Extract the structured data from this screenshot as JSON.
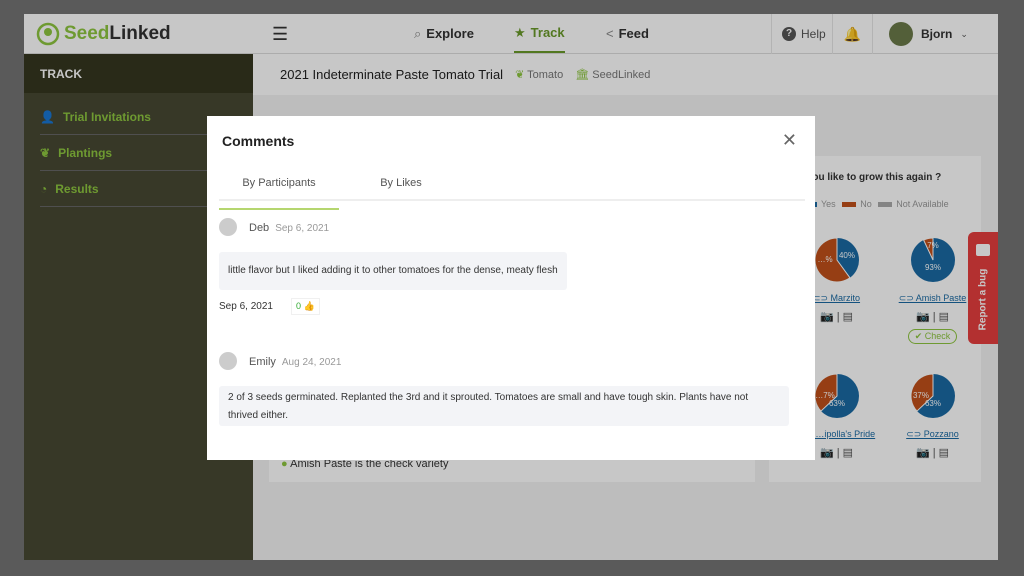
{
  "header": {
    "logo_seed": "Seed",
    "logo_linked": "Linked",
    "nav": [
      {
        "label": "Explore",
        "icon": "search-icon"
      },
      {
        "label": "Track",
        "icon": "star-icon"
      },
      {
        "label": "Feed",
        "icon": "share-icon"
      }
    ],
    "help": "Help",
    "user": "Bjorn"
  },
  "sidebar": {
    "title": "TRACK",
    "items": [
      {
        "label": "Trial Invitations",
        "icon": "user-plus-icon"
      },
      {
        "label": "Plantings",
        "icon": "seedling-icon"
      },
      {
        "label": "Results",
        "icon": "pie-chart-icon"
      }
    ]
  },
  "trial": {
    "title": "2021 Indeterminate Paste Tomato Trial",
    "crop": "Tomato",
    "org": "SeedLinked"
  },
  "results_card": {
    "question": "…uld you like to grow this again ?",
    "legend": [
      {
        "label": "Yes",
        "color": "#1a6aa3"
      },
      {
        "label": "No",
        "color": "#c0501a"
      },
      {
        "label": "Not Available",
        "color": "#aaaaaa"
      }
    ],
    "varieties": [
      {
        "name": "Marzito",
        "yes": 40,
        "no": 60,
        "yes_label": "40%",
        "no_label": "…%"
      },
      {
        "name": "Amish Paste",
        "yes": 93,
        "no": 7,
        "yes_label": "93%",
        "no_label": "7%",
        "check": "Check"
      },
      {
        "name": "…ipolla's Pride",
        "yes": 63,
        "no": 37,
        "yes_label": "63%",
        "no_label": "…7%"
      },
      {
        "name": "Pozzano",
        "yes": 63,
        "no": 37,
        "yes_label": "63%",
        "no_label": "37%"
      }
    ]
  },
  "check_note": "Amish Paste is the check variety",
  "report_bug": "Report a bug",
  "modal": {
    "title": "Comments",
    "tabs": [
      "By Participants",
      "By Likes"
    ],
    "comments": [
      {
        "name": "Deb",
        "date": "Sep 6, 2021",
        "text": "little flavor but I liked adding it to other tomatoes for the dense, meaty flesh",
        "footer_date": "Sep 6, 2021",
        "likes": "0"
      },
      {
        "name": "Emily",
        "date": "Aug 24, 2021",
        "text": "2 of 3 seeds germinated. Replanted the 3rd and it sprouted. Tomatoes are small and have tough skin. Plants have not thrived either."
      }
    ]
  }
}
